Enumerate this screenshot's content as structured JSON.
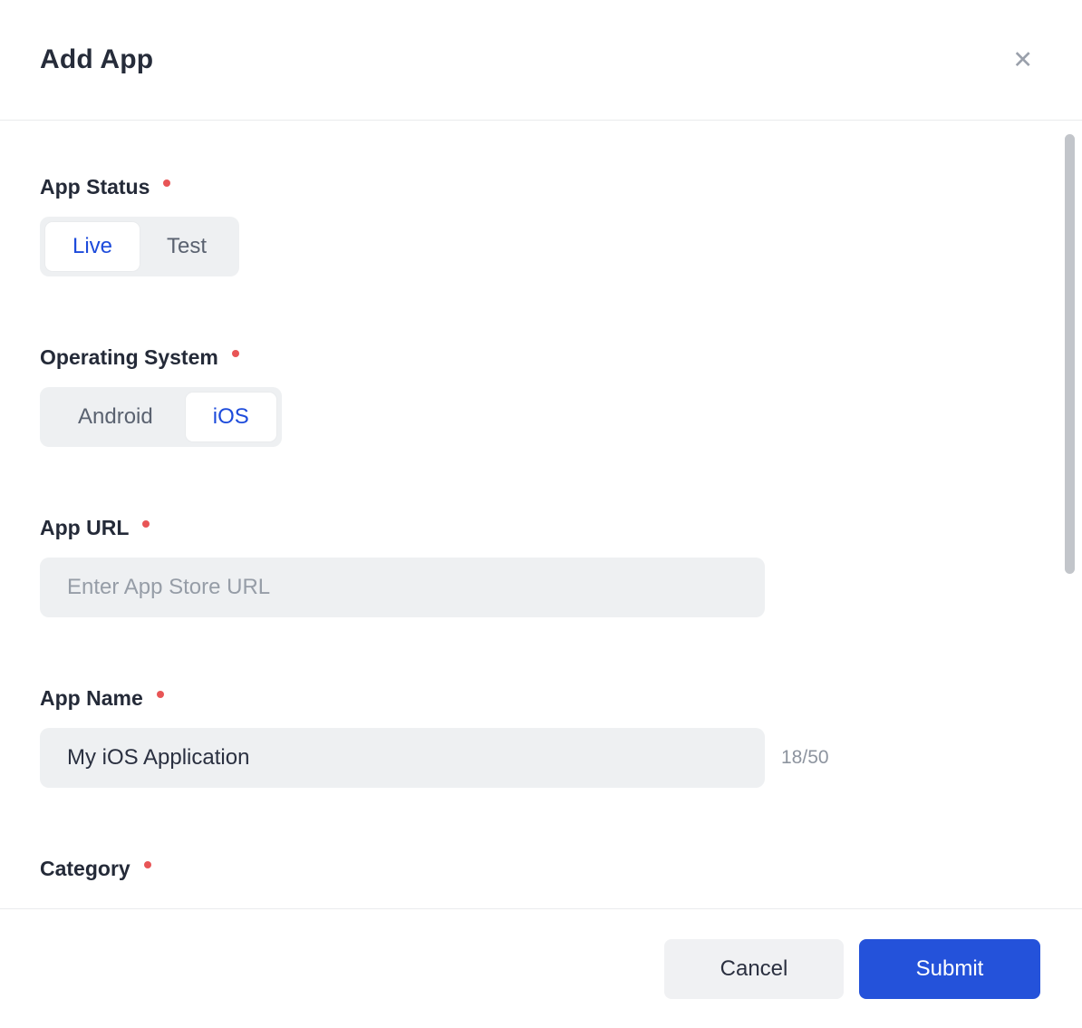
{
  "header": {
    "title": "Add App",
    "close_icon": "✕"
  },
  "form": {
    "app_status": {
      "label": "App Status",
      "required": true,
      "options": [
        "Live",
        "Test"
      ],
      "selected": "Live"
    },
    "operating_system": {
      "label": "Operating System",
      "required": true,
      "options": [
        "Android",
        "iOS"
      ],
      "selected": "iOS"
    },
    "app_url": {
      "label": "App URL",
      "required": true,
      "placeholder": "Enter App Store URL",
      "value": ""
    },
    "app_name": {
      "label": "App Name",
      "required": true,
      "value": "My iOS Application",
      "counter": "18/50"
    },
    "category": {
      "label": "Category",
      "required": true
    }
  },
  "footer": {
    "cancel_label": "Cancel",
    "submit_label": "Submit"
  },
  "colors": {
    "accent_blue": "#2452da",
    "selected_text_blue": "#1d4bdb",
    "required_dot_red": "#e85556",
    "field_background": "#eef0f2"
  }
}
